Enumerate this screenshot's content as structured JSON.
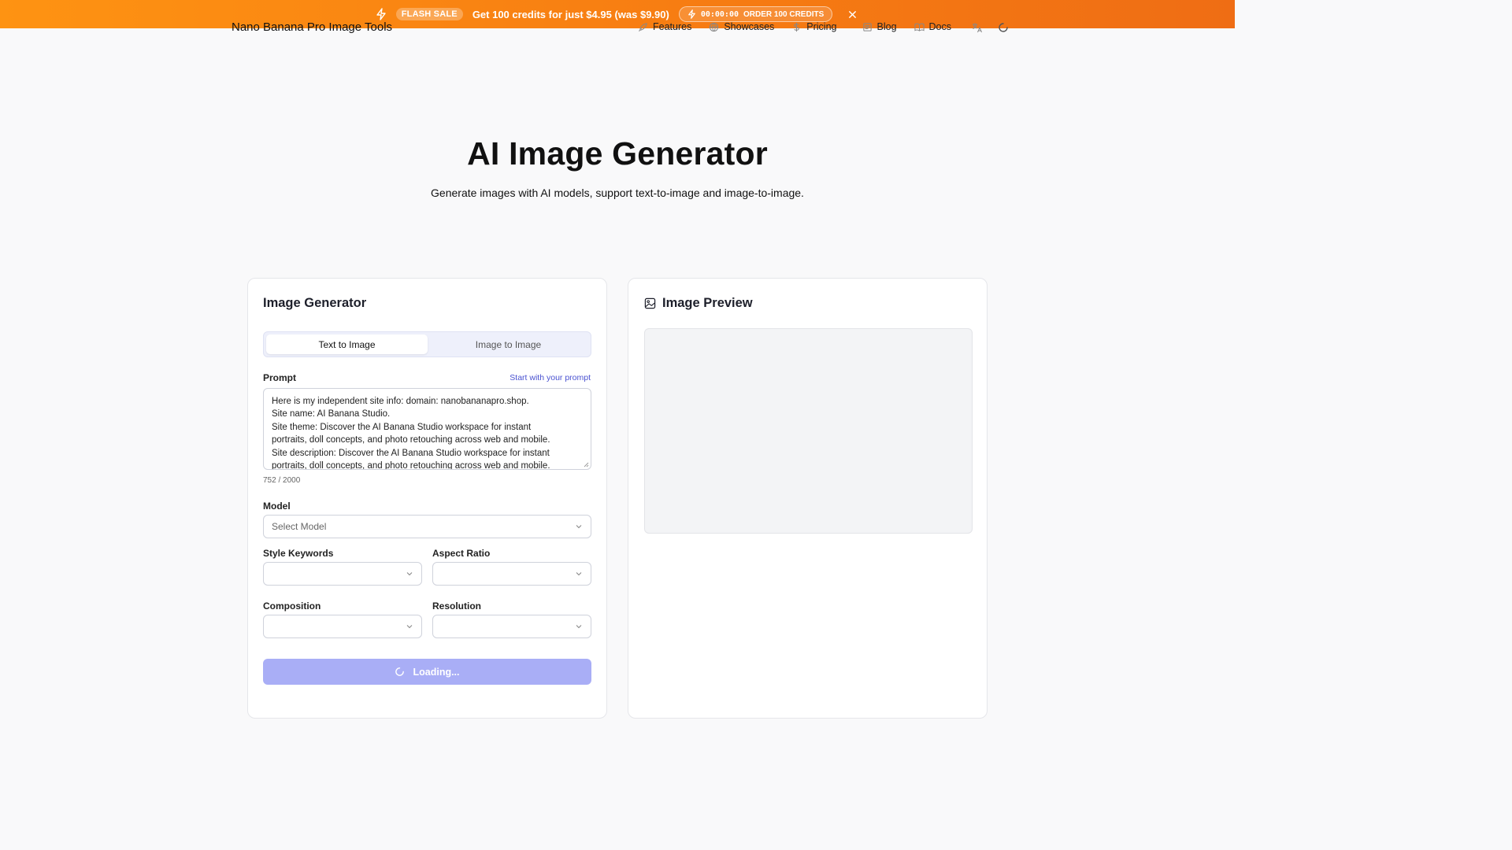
{
  "promo": {
    "badge": "FLASH SALE",
    "text": "Get 100 credits for just $4.95 (was $9.90)",
    "timer": "00:00:00",
    "cta": "ORDER 100 CREDITS"
  },
  "header": {
    "site_title": "Nano Banana Pro Image Tools",
    "nav": [
      {
        "label": "Features",
        "icon": "rocket-icon"
      },
      {
        "label": "Showcases",
        "icon": "globe-icon"
      },
      {
        "label": "Pricing",
        "icon": "dollar-icon"
      },
      {
        "label": "Blog",
        "icon": "newspaper-icon"
      },
      {
        "label": "Docs",
        "icon": "book-icon"
      }
    ]
  },
  "hero": {
    "title": "AI Image Generator",
    "subtitle": "Generate images with AI models, support text-to-image and image-to-image."
  },
  "generator": {
    "title": "Image Generator",
    "tabs": [
      "Text to Image",
      "Image to Image"
    ],
    "prompt_label": "Prompt",
    "prompt_link": "Start with your prompt",
    "prompt_lines": [
      "Here is my independent site info: domain: nanobananapro.shop.",
      "Site name: AI Banana Studio.",
      "Site theme: Discover the AI Banana Studio workspace for instant",
      "portraits, doll concepts, and photo retouching across web and mobile.",
      "Site description: Discover the AI Banana Studio workspace for instant",
      "portraits, doll concepts, and photo retouching across web and mobile."
    ],
    "counter": "752 / 2000",
    "model_label": "Model",
    "model_placeholder": "Select Model",
    "style_label": "Style Keywords",
    "aspect_label": "Aspect Ratio",
    "composition_label": "Composition",
    "resolution_label": "Resolution",
    "button_label": "Loading..."
  },
  "preview": {
    "title": "Image Preview"
  },
  "colors": {
    "banner_start": "#fe9312",
    "banner_end": "#ef6d14",
    "accent": "#4a52d1",
    "button_disabled": "#a9aef6"
  }
}
